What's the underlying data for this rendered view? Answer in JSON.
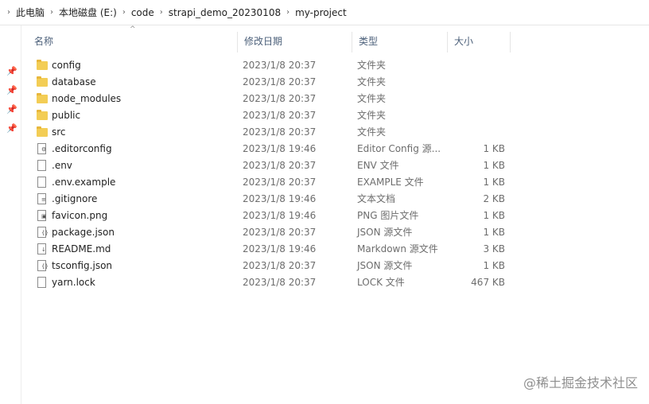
{
  "breadcrumb": {
    "items": [
      "此电脑",
      "本地磁盘 (E:)",
      "code",
      "strapi_demo_20230108",
      "my-project"
    ]
  },
  "columns": {
    "name": "名称",
    "date": "修改日期",
    "type": "类型",
    "size": "大小"
  },
  "files": [
    {
      "name": "config",
      "date": "2023/1/8 20:37",
      "type": "文件夹",
      "size": "",
      "icon": "folder-icon"
    },
    {
      "name": "database",
      "date": "2023/1/8 20:37",
      "type": "文件夹",
      "size": "",
      "icon": "folder-icon"
    },
    {
      "name": "node_modules",
      "date": "2023/1/8 20:37",
      "type": "文件夹",
      "size": "",
      "icon": "folder-icon"
    },
    {
      "name": "public",
      "date": "2023/1/8 20:37",
      "type": "文件夹",
      "size": "",
      "icon": "folder-icon"
    },
    {
      "name": "src",
      "date": "2023/1/8 20:37",
      "type": "文件夹",
      "size": "",
      "icon": "folder-icon"
    },
    {
      "name": ".editorconfig",
      "date": "2023/1/8 19:46",
      "type": "Editor Config 源...",
      "size": "1 KB",
      "icon": "config-file-icon"
    },
    {
      "name": ".env",
      "date": "2023/1/8 20:37",
      "type": "ENV 文件",
      "size": "1 KB",
      "icon": "file-icon"
    },
    {
      "name": ".env.example",
      "date": "2023/1/8 20:37",
      "type": "EXAMPLE 文件",
      "size": "1 KB",
      "icon": "file-icon"
    },
    {
      "name": ".gitignore",
      "date": "2023/1/8 19:46",
      "type": "文本文档",
      "size": "2 KB",
      "icon": "text-file-icon"
    },
    {
      "name": "favicon.png",
      "date": "2023/1/8 19:46",
      "type": "PNG 图片文件",
      "size": "1 KB",
      "icon": "image-file-icon"
    },
    {
      "name": "package.json",
      "date": "2023/1/8 20:37",
      "type": "JSON 源文件",
      "size": "1 KB",
      "icon": "json-file-icon"
    },
    {
      "name": "README.md",
      "date": "2023/1/8 19:46",
      "type": "Markdown 源文件",
      "size": "3 KB",
      "icon": "markdown-file-icon"
    },
    {
      "name": "tsconfig.json",
      "date": "2023/1/8 20:37",
      "type": "JSON 源文件",
      "size": "1 KB",
      "icon": "json-file-icon"
    },
    {
      "name": "yarn.lock",
      "date": "2023/1/8 20:37",
      "type": "LOCK 文件",
      "size": "467 KB",
      "icon": "file-icon"
    }
  ],
  "watermark": "@稀土掘金技术社区",
  "colors": {
    "folder": "#f3cd55",
    "header_text": "#4c607a",
    "secondary_text": "#6d6d6d"
  }
}
